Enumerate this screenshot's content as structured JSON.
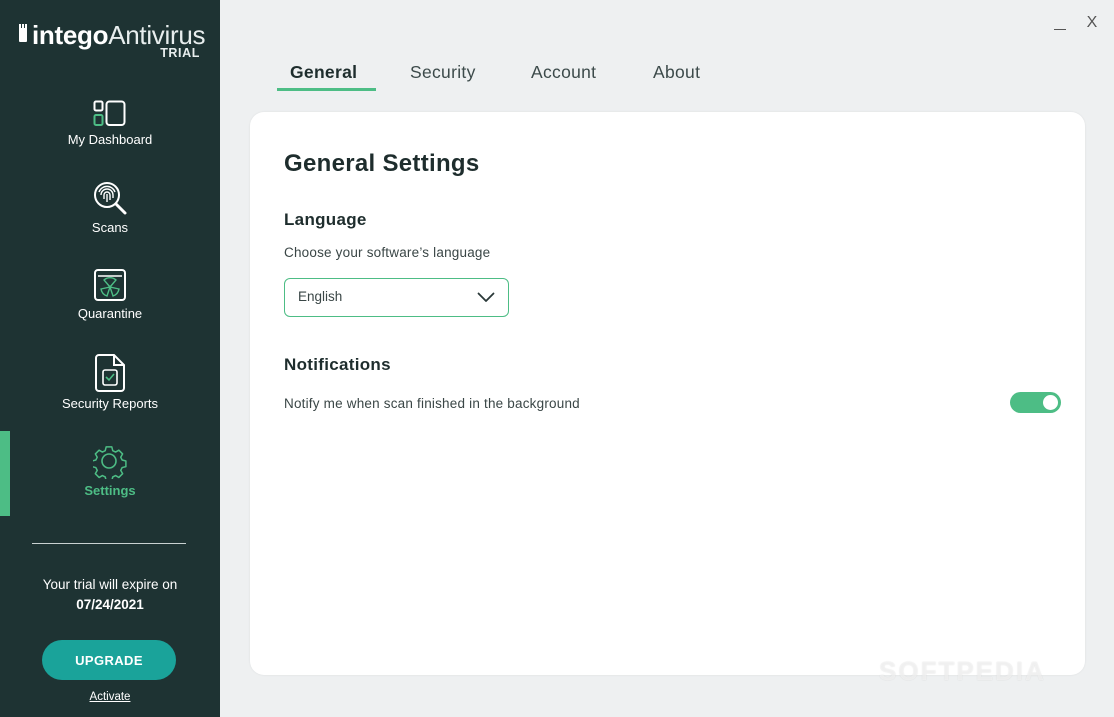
{
  "app": {
    "brand": "intego",
    "product": "Antivirus",
    "edition": "TRIAL"
  },
  "sidebar": {
    "items": [
      {
        "label": "My Dashboard",
        "icon": "dashboard-icon"
      },
      {
        "label": "Scans",
        "icon": "fingerprint-scan-icon"
      },
      {
        "label": "Quarantine",
        "icon": "quarantine-icon"
      },
      {
        "label": "Security Reports",
        "icon": "report-icon"
      },
      {
        "label": "Settings",
        "icon": "gear-icon",
        "active": true
      }
    ],
    "trial_text": "Your trial will expire on",
    "trial_date": "07/24/2021",
    "upgrade_label": "UPGRADE",
    "activate_label": "Activate"
  },
  "window": {
    "minimize": "_",
    "close": "X"
  },
  "tabs": [
    {
      "label": "General",
      "active": true
    },
    {
      "label": "Security"
    },
    {
      "label": "Account"
    },
    {
      "label": "About"
    }
  ],
  "main": {
    "title": "General Settings",
    "language": {
      "heading": "Language",
      "description": "Choose your software’s language",
      "selected": "English"
    },
    "notifications": {
      "heading": "Notifications",
      "description": "Notify me when scan finished in the background",
      "toggle_on": true
    }
  },
  "watermark": "SOFTPEDIA",
  "colors": {
    "sidebar_bg": "#1e3333",
    "accent_green": "#4dbd85",
    "upgrade_teal": "#1aa39a",
    "content_bg": "#eef0f1"
  }
}
